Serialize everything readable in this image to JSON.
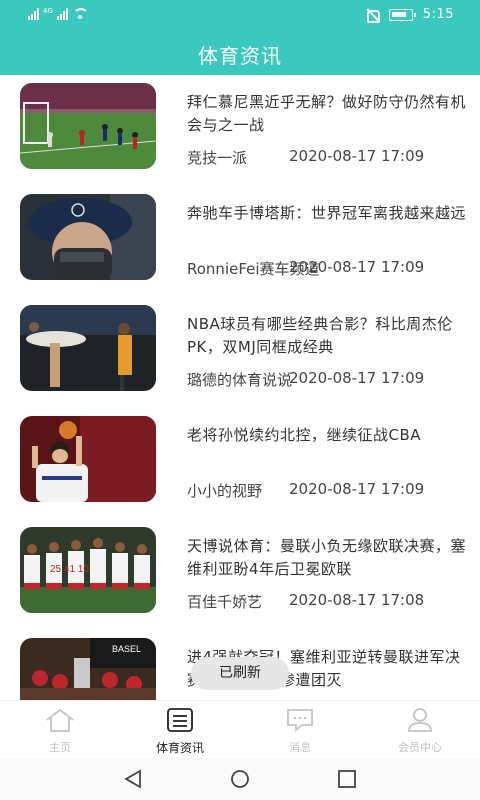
{
  "status_bar": {
    "network_tag": "4G",
    "time": "5:15"
  },
  "header": {
    "title": "体育资讯"
  },
  "articles": [
    {
      "title": "拜仁慕尼黑近乎无解？做好防守仍然有机会与之一战",
      "author": "竞技一派",
      "date": "2020-08-17 17:09"
    },
    {
      "title": "奔驰车手博塔斯：世界冠军离我越来越远",
      "author": "RonnieFei赛车频道",
      "date": "2020-08-17 17:09"
    },
    {
      "title": "NBA球员有哪些经典合影？科比周杰伦PK，双MJ同框成经典",
      "author": "璐德的体育说说",
      "date": "2020-08-17 17:09"
    },
    {
      "title": "老将孙悦续约北控，继续征战CBA",
      "author": "小小的视野",
      "date": "2020-08-17 17:09"
    },
    {
      "title": "天博说体育：曼联小负无缘欧联决赛，塞维利亚盼4年后卫冕欧联",
      "author": "百佳千娇艺",
      "date": "2020-08-17 17:08"
    },
    {
      "title": "进4强就夺冠！塞维利亚逆转曼联进军决赛，英超欧战惨遭团灭",
      "author": "",
      "date": ""
    }
  ],
  "toast": "已刷新",
  "tabs": [
    {
      "label": "主页",
      "icon": "home-icon"
    },
    {
      "label": "体育资讯",
      "icon": "news-icon"
    },
    {
      "label": "消息",
      "icon": "message-icon"
    },
    {
      "label": "会员中心",
      "icon": "user-icon"
    }
  ],
  "colors": {
    "accent": "#3cc9bd",
    "text": "#333333",
    "tab_inactive": "#c3c3c3"
  }
}
